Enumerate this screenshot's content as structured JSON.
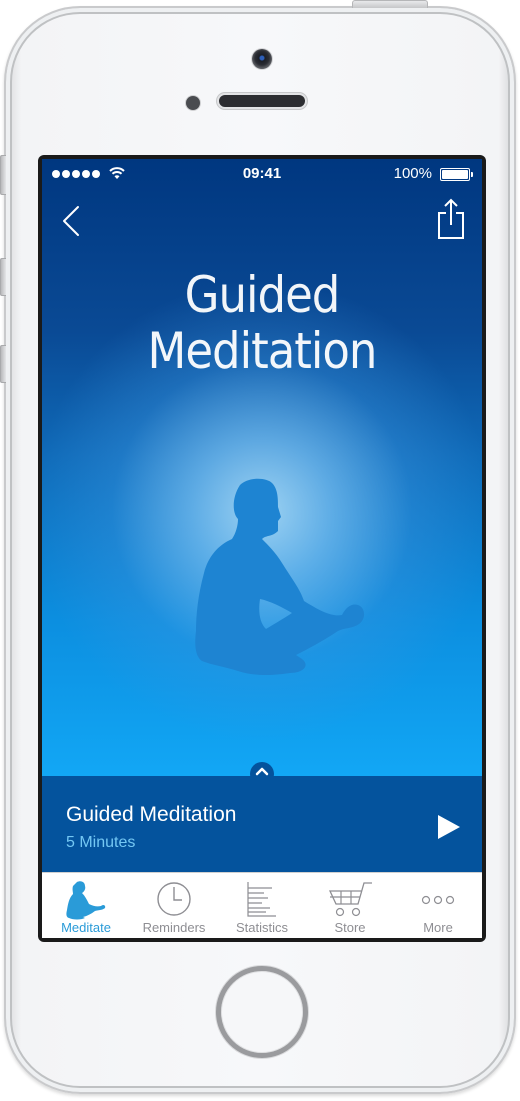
{
  "device": {
    "model": "iPhone",
    "color": "silver"
  },
  "status_bar": {
    "signal_dots": 5,
    "wifi": "wifi-icon",
    "time": "09:41",
    "battery_percent": "100%",
    "battery_level": 1.0
  },
  "nav": {
    "back_icon": "chevron-left-icon",
    "share_icon": "share-icon"
  },
  "hero": {
    "title_line1": "Guided",
    "title_line2": "Meditation",
    "illustration": "meditating-person-silhouette",
    "expand_icon": "chevron-up-icon"
  },
  "now_playing": {
    "title": "Guided Meditation",
    "duration": "5 Minutes",
    "play_icon": "play-icon"
  },
  "tab_bar": {
    "active_index": 0,
    "tabs": [
      {
        "label": "Meditate",
        "icon": "meditate-icon"
      },
      {
        "label": "Reminders",
        "icon": "clock-icon"
      },
      {
        "label": "Statistics",
        "icon": "statistics-icon"
      },
      {
        "label": "Store",
        "icon": "cart-icon"
      },
      {
        "label": "More",
        "icon": "more-icon"
      }
    ]
  },
  "colors": {
    "header_blue": "#003780",
    "bottom_hero_blue": "#12a7f5",
    "now_playing_bg": "#04539d",
    "duration_text": "#74c7f3",
    "tab_active": "#2a9bd8",
    "tab_inactive": "#8e8e93"
  }
}
